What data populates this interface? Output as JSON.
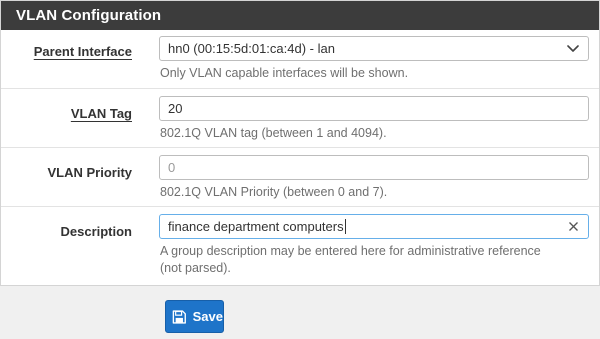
{
  "panel": {
    "title": "VLAN Configuration"
  },
  "fields": {
    "parent_interface": {
      "label": "Parent Interface",
      "value": "hn0 (00:15:5d:01:ca:4d) - lan",
      "help": "Only VLAN capable interfaces will be shown."
    },
    "vlan_tag": {
      "label": "VLAN Tag",
      "value": "20",
      "help": "802.1Q VLAN tag (between 1 and 4094)."
    },
    "vlan_priority": {
      "label": "VLAN Priority",
      "value": "",
      "placeholder": "0",
      "help": "802.1Q VLAN Priority (between 0 and 7)."
    },
    "description": {
      "label": "Description",
      "value": "finance department computers",
      "help_line1": "A group description may be entered here for administrative reference",
      "help_line2": "(not parsed)."
    }
  },
  "actions": {
    "save_label": "Save"
  },
  "colors": {
    "header_bg": "#3c3c3c",
    "primary_button": "#1e74c9",
    "focus_border": "#66afe9"
  },
  "icons": {
    "select": "chevron-down-icon",
    "clear": "close-icon",
    "save": "floppy-disk-icon"
  }
}
